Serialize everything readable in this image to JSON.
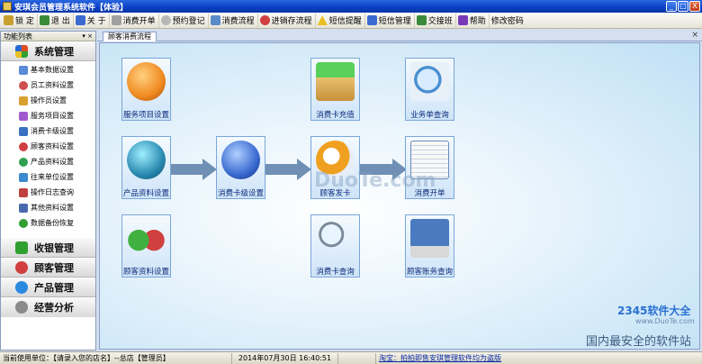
{
  "window": {
    "title": "安琪会员管理系统软件【体验】",
    "buttons": [
      "_",
      "□",
      "X"
    ]
  },
  "toolbar": {
    "items": [
      {
        "label": "锁 定",
        "icon": "lock-icon",
        "color": "#c8a030"
      },
      {
        "label": "退 出",
        "icon": "exit-icon",
        "color": "#3a8a3a"
      },
      {
        "label": "关 于",
        "icon": "info-icon",
        "color": "#3a6ad0"
      },
      {
        "label": "消费开单",
        "icon": "order-icon",
        "color": "#a0a0a0"
      },
      {
        "label": "预约登记",
        "icon": "booking-icon",
        "color": "#b8b8b8"
      },
      {
        "label": "消费流程",
        "icon": "flow-icon",
        "color": "#5a8ac8"
      },
      {
        "label": "进销存流程",
        "icon": "stock-icon",
        "color": "#d04040"
      },
      {
        "label": "短信提醒",
        "icon": "warning-icon",
        "color": "#e8c020"
      },
      {
        "label": "短信管理",
        "icon": "sms-icon",
        "color": "#3a6ad0"
      },
      {
        "label": "交接班",
        "icon": "handover-icon",
        "color": "#3a8a3a"
      },
      {
        "label": "帮助",
        "icon": "help-icon",
        "color": "#7a3ab8"
      },
      {
        "label": "修改密码",
        "icon": "password-icon",
        "color": "#888888"
      }
    ]
  },
  "sidebar": {
    "header": "功能列表",
    "pin": "▾ ×",
    "groups": [
      {
        "label": "系统管理",
        "icon": "windows-icon",
        "color": "#e05020"
      },
      {
        "label": "收银管理",
        "icon": "cash-icon",
        "color": "#30a030"
      },
      {
        "label": "顾客管理",
        "icon": "customer-icon",
        "color": "#d04040"
      },
      {
        "label": "产品管理",
        "icon": "product-icon",
        "color": "#2a8ae0"
      },
      {
        "label": "经营分析",
        "icon": "analysis-icon",
        "color": "#8a8a8a"
      }
    ],
    "sub_items": [
      {
        "label": "基本数据设置",
        "color": "#5a8ad8"
      },
      {
        "label": "员工资料设置",
        "color": "#d05050"
      },
      {
        "label": "操作员设置",
        "color": "#d8a030"
      },
      {
        "label": "服务项目设置",
        "color": "#a05ad0"
      },
      {
        "label": "消费卡级设置",
        "color": "#3a70c0"
      },
      {
        "label": "顾客资料设置",
        "color": "#d04040"
      },
      {
        "label": "产品资料设置",
        "color": "#30a050"
      },
      {
        "label": "往来单位设置",
        "color": "#3a8ad0"
      },
      {
        "label": "操作日志查询",
        "color": "#c04040"
      },
      {
        "label": "其他资料设置",
        "color": "#4a6ab0"
      },
      {
        "label": "数据备份恢复",
        "color": "#30a030"
      }
    ]
  },
  "tab": {
    "label": "顾客消费流程",
    "close": "×"
  },
  "tiles": [
    {
      "label": "服务项目设置",
      "icon": "service-setup-icon",
      "color": "#f08a20"
    },
    {
      "label": "消费卡充值",
      "icon": "card-recharge-icon",
      "color": "#30a030"
    },
    {
      "label": "业务单查询",
      "icon": "order-search-icon",
      "color": "#4a90d0"
    },
    {
      "label": "产品资料设置",
      "icon": "product-setup-icon",
      "color": "#2a8ab0"
    },
    {
      "label": "消费卡级设置",
      "icon": "card-level-icon",
      "color": "#3a6ad0"
    },
    {
      "label": "顾客发卡",
      "icon": "issue-card-icon",
      "color": "#f0a020"
    },
    {
      "label": "消费开单",
      "icon": "consume-order-icon",
      "color": "#6a8ab8"
    },
    {
      "label": "顾客资料设置",
      "icon": "customer-setup-icon",
      "color": "#d04040"
    },
    {
      "label": "消费卡查询",
      "icon": "card-search-icon",
      "color": "#4a90d0"
    },
    {
      "label": "顾客账务查询",
      "icon": "account-search-icon",
      "color": "#4a7ac0"
    }
  ],
  "watermarks": {
    "center": "DuoTe.com",
    "corner_brand": "2345软件大全",
    "corner_url": "www.DuoTe.com",
    "corner_slogan": "国内最安全的软件站"
  },
  "status": {
    "unit_label": "当前使用单位：",
    "unit_value": "【请录入您的店名】--总店【管理员】",
    "datetime": "2014年07月30日  16:40:51",
    "link": "淘宝：拍拍即售安琪管理软件均为盗版"
  }
}
